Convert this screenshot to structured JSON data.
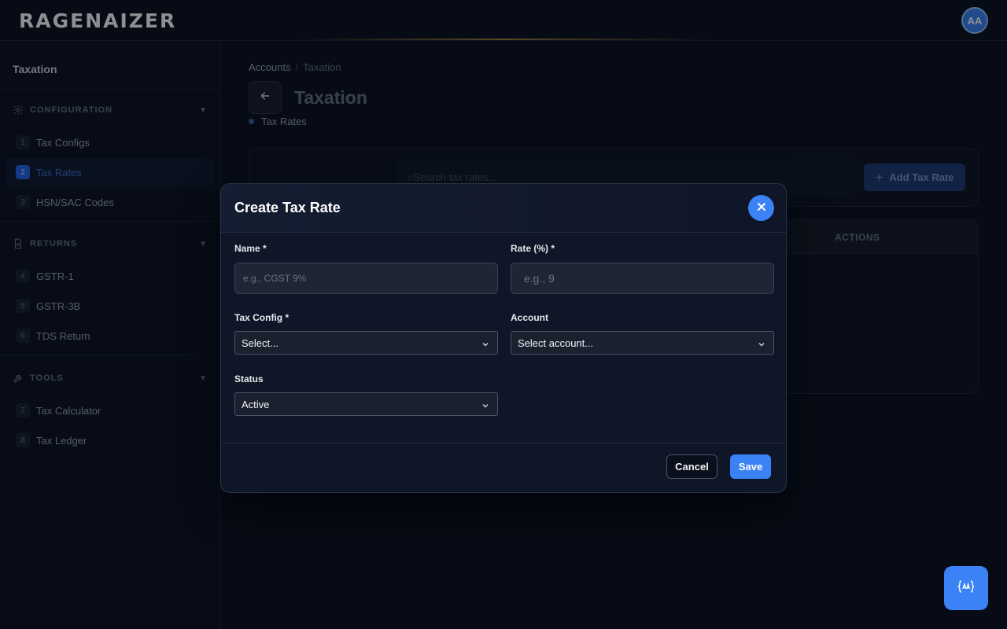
{
  "app": {
    "logo_text": "RAGENAIZER",
    "avatar_initials": "AA"
  },
  "sidebar": {
    "title": "Taxation",
    "sections": [
      {
        "label": "CONFIGURATION",
        "icon": "gear-icon",
        "items": [
          {
            "num": "1",
            "label": "Tax Configs"
          },
          {
            "num": "2",
            "label": "Tax Rates",
            "active": true
          },
          {
            "num": "3",
            "label": "HSN/SAC Codes"
          }
        ]
      },
      {
        "label": "RETURNS",
        "icon": "document-icon",
        "items": [
          {
            "num": "4",
            "label": "GSTR-1"
          },
          {
            "num": "5",
            "label": "GSTR-3B"
          },
          {
            "num": "6",
            "label": "TDS Return"
          }
        ]
      },
      {
        "label": "TOOLS",
        "icon": "wrench-icon",
        "items": [
          {
            "num": "7",
            "label": "Tax Calculator"
          },
          {
            "num": "8",
            "label": "Tax Ledger"
          }
        ]
      }
    ]
  },
  "main": {
    "breadcrumb": {
      "parent": "Accounts",
      "separator": "/",
      "current": "Taxation"
    },
    "title": "Taxation",
    "subtab": "Tax Rates",
    "search_placeholder": "Search tax rates...",
    "add_button_label": "Add Tax Rate",
    "table_headers": {
      "actions": "ACTIONS"
    }
  },
  "modal": {
    "title": "Create Tax Rate",
    "fields": {
      "name": {
        "label": "Name *",
        "placeholder": "e.g., CGST 9%",
        "value": ""
      },
      "rate": {
        "label": "Rate (%) *",
        "placeholder": "e.g., 9",
        "value": ""
      },
      "tax_config": {
        "label": "Tax Config *",
        "selected": "Select..."
      },
      "account": {
        "label": "Account",
        "selected": "Select account..."
      },
      "status": {
        "label": "Status",
        "selected": "Active"
      }
    },
    "cancel_label": "Cancel",
    "save_label": "Save"
  },
  "colors": {
    "accent": "#3b82f6",
    "background": "#0a0f1c",
    "modal_bg": "#0f1627"
  }
}
